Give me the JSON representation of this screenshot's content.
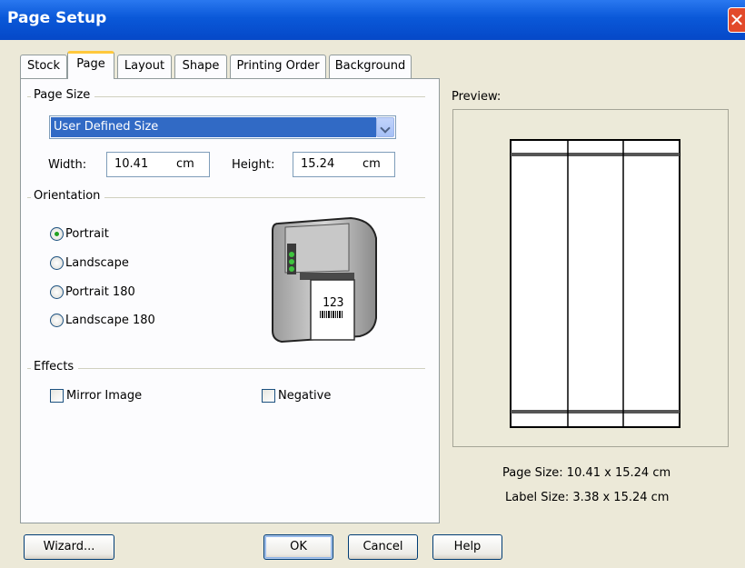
{
  "window": {
    "title": "Page Setup",
    "close_glyph": "✕"
  },
  "tabs": [
    "Stock",
    "Page",
    "Layout",
    "Shape",
    "Printing Order",
    "Background"
  ],
  "active_tab": "Page",
  "page_size": {
    "group_label": "Page Size",
    "selected_size": "User Defined Size",
    "width_label": "Width:",
    "width_value": "10.41",
    "width_unit": "cm",
    "height_label": "Height:",
    "height_value": "15.24",
    "height_unit": "cm"
  },
  "orientation": {
    "group_label": "Orientation",
    "options": [
      "Portrait",
      "Landscape",
      "Portrait 180",
      "Landscape 180"
    ],
    "selected": "Portrait",
    "printer_label_text": "123"
  },
  "effects": {
    "group_label": "Effects",
    "mirror_image": "Mirror Image",
    "negative": "Negative"
  },
  "preview": {
    "label": "Preview:",
    "page_size_text": "Page Size:  10.41 x 15.24 cm",
    "label_size_text": "Label Size:  3.38 x 15.24 cm"
  },
  "buttons": {
    "wizard": "Wizard...",
    "ok": "OK",
    "cancel": "Cancel",
    "help": "Help"
  },
  "colors": {
    "titlebar": "#0a58d8",
    "selection": "#316ac5",
    "radio_dot": "#21a121",
    "active_tab_accent": "#ffc83c"
  }
}
